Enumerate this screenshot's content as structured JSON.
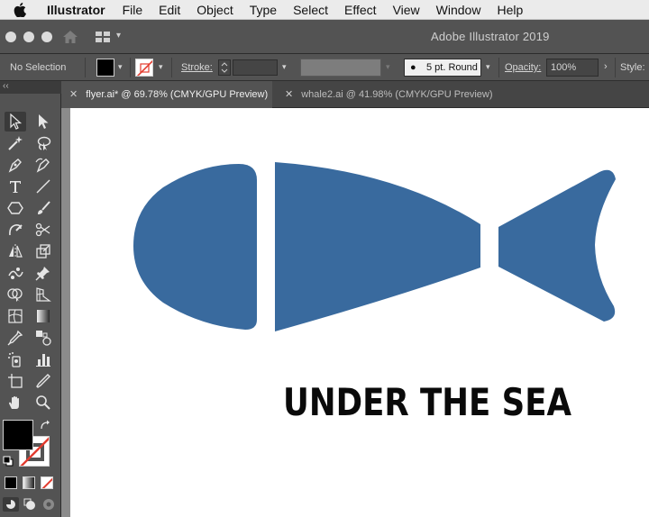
{
  "menubar": {
    "app_name": "Illustrator",
    "items": [
      "File",
      "Edit",
      "Object",
      "Type",
      "Select",
      "Effect",
      "View",
      "Window",
      "Help"
    ]
  },
  "titlebar": {
    "title": "Adobe Illustrator 2019"
  },
  "controlbar": {
    "selection": "No Selection",
    "stroke_label": "Stroke:",
    "brush": "5 pt. Round",
    "opacity_label": "Opacity:",
    "opacity_value": "100%",
    "style_label": "Style:"
  },
  "tabs": [
    {
      "label": "flyer.ai* @ 69.78% (CMYK/GPU Preview)",
      "active": true
    },
    {
      "label": "whale2.ai @ 41.98% (CMYK/GPU Preview)",
      "active": false
    }
  ],
  "artwork": {
    "headline": "UNDER THE SEA",
    "fish_color": "#396a9e"
  },
  "colors": {
    "fill": "#000000",
    "stroke_none": "#e23b2e",
    "panel": "#535353"
  }
}
